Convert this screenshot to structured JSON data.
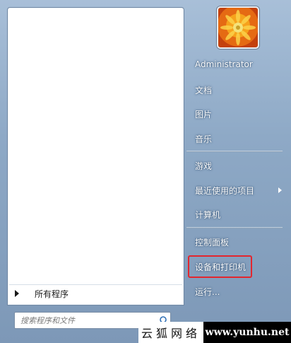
{
  "user": {
    "name": "Administrator"
  },
  "menu": {
    "items": [
      {
        "label": "文档"
      },
      {
        "label": "图片"
      },
      {
        "label": "音乐"
      },
      {
        "label": "游戏"
      },
      {
        "label": "最近使用的项目",
        "submenu": true
      },
      {
        "label": "计算机"
      },
      {
        "label": "控制面板"
      },
      {
        "label": "设备和打印机",
        "highlighted": true
      },
      {
        "label": "运行..."
      }
    ]
  },
  "all_programs": {
    "label": "所有程序"
  },
  "search": {
    "placeholder": "搜索程序和文件"
  },
  "watermark": {
    "site_name": "云狐网络",
    "url": "www.yunhu.net"
  },
  "colors": {
    "highlight": "#e3262e",
    "menu_text": "#ffffff"
  }
}
